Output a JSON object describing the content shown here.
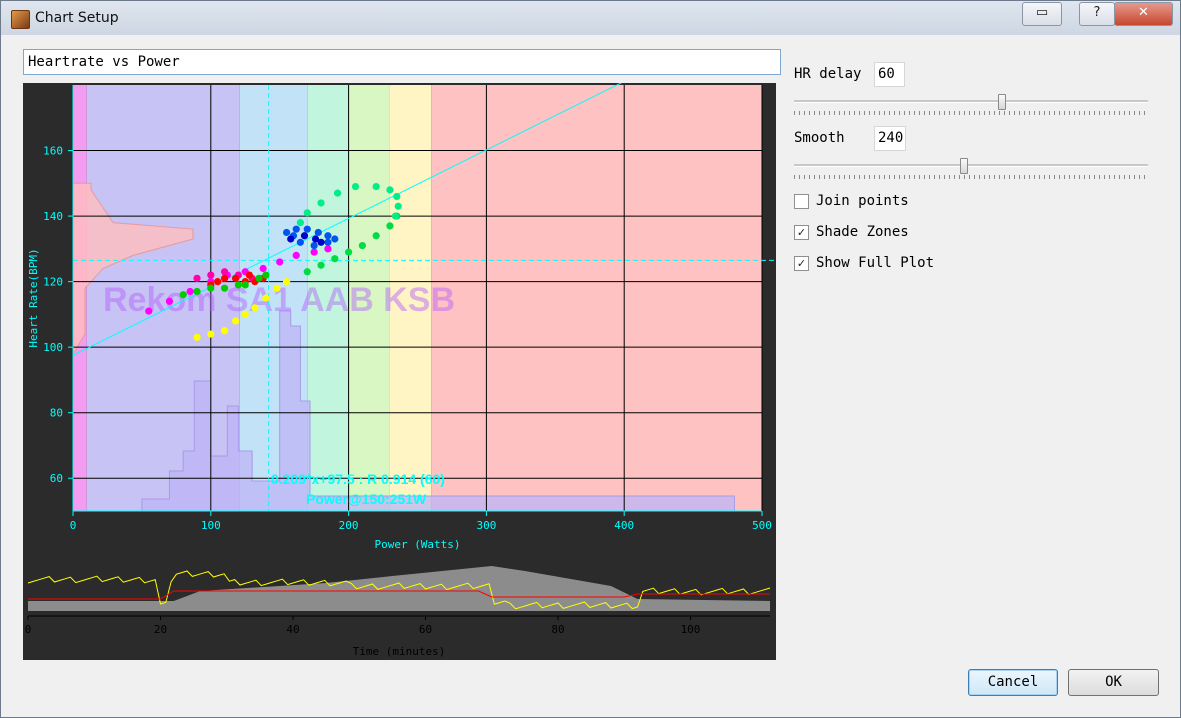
{
  "window": {
    "title": "Chart Setup",
    "title_buttons": {
      "restore": "▭",
      "help": "?",
      "close": "✕"
    }
  },
  "chart_title_input": {
    "value": "Heartrate vs Power"
  },
  "chart_data": [
    {
      "type": "scatter",
      "title": "Heartrate vs Power",
      "xlabel": "Power (Watts)",
      "ylabel": "Heart Rate(BPM)",
      "xlim": [
        0,
        500
      ],
      "ylim": [
        50,
        180
      ],
      "x_ticks": [
        "0",
        "100",
        "200",
        "300",
        "400",
        "500"
      ],
      "y_ticks": [
        "60",
        "80",
        "100",
        "120",
        "140",
        "160"
      ],
      "grid": true,
      "zones": [
        {
          "from": 0,
          "to": 10,
          "color": "#f29df2"
        },
        {
          "from": 10,
          "to": 121,
          "color": "#c7c3f5"
        },
        {
          "from": 121,
          "to": 170,
          "color": "#c2e3f7"
        },
        {
          "from": 170,
          "to": 200,
          "color": "#c2f5dd"
        },
        {
          "from": 200,
          "to": 230,
          "color": "#d8f7c2"
        },
        {
          "from": 230,
          "to": 260,
          "color": "#fff5c4"
        },
        {
          "from": 260,
          "to": 500,
          "color": "#ffc2c2"
        }
      ],
      "zone_watermark": "Rekom SA1 AAB KSB",
      "regression": {
        "slope": 0.209,
        "intercept": 97.5,
        "r": 0.914,
        "delay": 60
      },
      "regression_label": "0.209*x+97.5 : R 0.914 (60)",
      "power_label": "Power@150:251W",
      "series": [
        {
          "color": "#ff00ff",
          "points": [
            [
              55,
              111
            ],
            [
              70,
              114
            ],
            [
              85,
              117
            ],
            [
              100,
              120
            ],
            [
              112,
              122
            ],
            [
              125,
              123
            ],
            [
              138,
              124
            ],
            [
              150,
              126
            ],
            [
              162,
              128
            ],
            [
              175,
              129
            ],
            [
              185,
              130
            ]
          ]
        },
        {
          "color": "#ff00aa",
          "points": [
            [
              90,
              121
            ],
            [
              100,
              122
            ],
            [
              110,
              123
            ],
            [
              120,
              122
            ],
            [
              130,
              121
            ]
          ]
        },
        {
          "color": "#ff0000",
          "points": [
            [
              100,
              119
            ],
            [
              105,
              120
            ],
            [
              110,
              121
            ],
            [
              118,
              121
            ],
            [
              125,
              120
            ],
            [
              132,
              120
            ],
            [
              138,
              121
            ],
            [
              128,
              122
            ]
          ]
        },
        {
          "color": "#00cc00",
          "points": [
            [
              80,
              116
            ],
            [
              90,
              117
            ],
            [
              100,
              118
            ],
            [
              110,
              118
            ],
            [
              120,
              119
            ],
            [
              125,
              119
            ],
            [
              135,
              121
            ],
            [
              140,
              122
            ]
          ]
        },
        {
          "color": "#ffff00",
          "points": [
            [
              90,
              103
            ],
            [
              100,
              104
            ],
            [
              110,
              105
            ],
            [
              118,
              108
            ],
            [
              125,
              110
            ],
            [
              132,
              112
            ],
            [
              140,
              115
            ],
            [
              148,
              118
            ],
            [
              155,
              120
            ]
          ]
        },
        {
          "color": "#00dd44",
          "points": [
            [
              170,
              123
            ],
            [
              180,
              125
            ],
            [
              190,
              127
            ],
            [
              200,
              129
            ],
            [
              210,
              131
            ],
            [
              220,
              134
            ],
            [
              230,
              137
            ],
            [
              235,
              140
            ]
          ]
        },
        {
          "color": "#00ee88",
          "points": [
            [
              165,
              138
            ],
            [
              170,
              141
            ],
            [
              180,
              144
            ],
            [
              192,
              147
            ],
            [
              205,
              149
            ],
            [
              220,
              149
            ],
            [
              230,
              148
            ],
            [
              235,
              146
            ],
            [
              236,
              143
            ],
            [
              234,
              140
            ]
          ]
        },
        {
          "color": "#0055ee",
          "points": [
            [
              155,
              135
            ],
            [
              162,
              136
            ],
            [
              170,
              136
            ],
            [
              178,
              135
            ],
            [
              185,
              134
            ],
            [
              190,
              133
            ],
            [
              185,
              132
            ],
            [
              175,
              131
            ],
            [
              165,
              132
            ],
            [
              160,
              134
            ]
          ]
        },
        {
          "color": "#0000cc",
          "points": [
            [
              158,
              133
            ],
            [
              168,
              134
            ],
            [
              176,
              133
            ],
            [
              180,
              132
            ]
          ]
        }
      ]
    },
    {
      "type": "line",
      "xlabel": "Time (minutes)",
      "x_ticks": [
        "0",
        "20",
        "40",
        "60",
        "80",
        "100"
      ],
      "xlim": [
        0,
        112
      ]
    }
  ],
  "settings": {
    "hr_delay": {
      "label": "HR delay",
      "value": "60",
      "slider_fraction": 0.59
    },
    "smooth": {
      "label": "Smooth",
      "value": "240",
      "slider_fraction": 0.48
    },
    "join_points": {
      "label": "Join points",
      "checked": false
    },
    "shade_zones": {
      "label": "Shade Zones",
      "checked": true
    },
    "show_full_plot": {
      "label": "Show Full Plot",
      "checked": true
    }
  },
  "buttons": {
    "cancel": "Cancel",
    "ok": "OK"
  },
  "colors": {
    "plot_bg": "#2b2b2b",
    "axis": "#00ffff",
    "hr_line": "#ff0000",
    "power_line": "#ffff00",
    "altitude": "#8c8c8c"
  }
}
